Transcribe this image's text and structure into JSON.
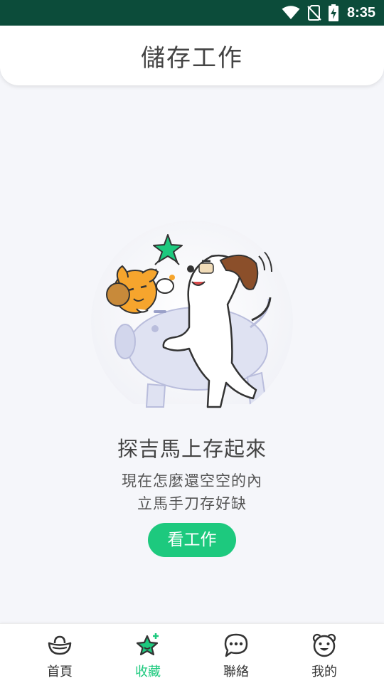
{
  "status_bar": {
    "time": "8:35",
    "icons": [
      "wifi-icon",
      "no-sim-icon",
      "battery-charging-icon"
    ]
  },
  "header": {
    "title": "儲存工作"
  },
  "empty_state": {
    "title": "探吉馬上存起來",
    "line1": "現在怎麼還空空的內",
    "line2": "立馬手刀存好缺",
    "button_label": "看工作"
  },
  "bottom_nav": {
    "items": [
      {
        "label": "首頁",
        "icon": "ingot-icon",
        "active": false
      },
      {
        "label": "收藏",
        "icon": "star-icon",
        "active": true
      },
      {
        "label": "聯絡",
        "icon": "chat-bubble-icon",
        "active": false
      },
      {
        "label": "我的",
        "icon": "bear-face-icon",
        "active": false
      }
    ]
  },
  "colors": {
    "status_bar": "#0c4c3a",
    "accent": "#1dc97e",
    "background": "#f5f6fa",
    "text": "#444444"
  }
}
